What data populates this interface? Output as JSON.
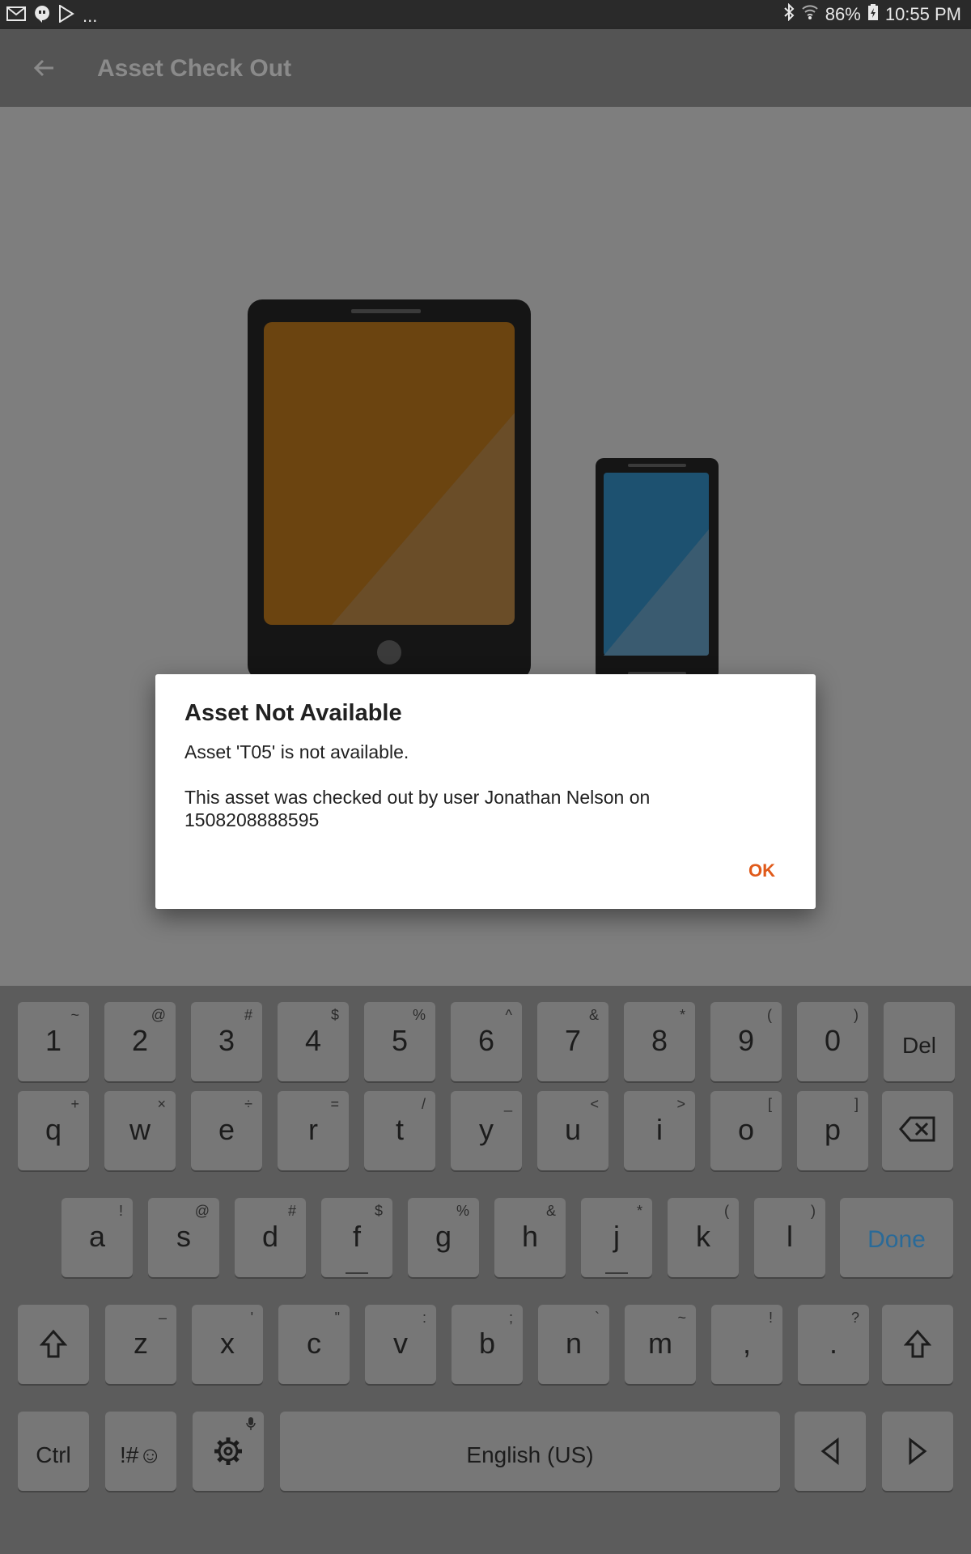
{
  "status_bar": {
    "battery": "86%",
    "time": "10:55 PM",
    "notification_overflow": "...",
    "icons": [
      "gmail-icon",
      "hangouts-icon",
      "play-store-icon",
      "bluetooth-icon",
      "wifi-icon",
      "battery-icon"
    ]
  },
  "app_bar": {
    "title": "Asset Check Out",
    "back_icon": "arrow-back-icon"
  },
  "dialog": {
    "title": "Asset Not Available",
    "line1": "Asset 'T05' is not available.",
    "line2": "This asset was checked out by user Jonathan Nelson on",
    "line3": "1508208888595",
    "ok_label": "OK"
  },
  "colors": {
    "accent": "#e05a1a",
    "done_key": "#2a6a98",
    "tablet_screen": "#6b4410",
    "phone_screen": "#1d5170"
  },
  "keyboard": {
    "row1": [
      {
        "main": "1",
        "sub": "~"
      },
      {
        "main": "2",
        "sub": "@"
      },
      {
        "main": "3",
        "sub": "#"
      },
      {
        "main": "4",
        "sub": "$"
      },
      {
        "main": "5",
        "sub": "%"
      },
      {
        "main": "6",
        "sub": "^"
      },
      {
        "main": "7",
        "sub": "&"
      },
      {
        "main": "8",
        "sub": "*"
      },
      {
        "main": "9",
        "sub": "("
      },
      {
        "main": "0",
        "sub": ")"
      },
      {
        "main": "Del",
        "sub": ""
      }
    ],
    "row2": [
      {
        "main": "q",
        "sub": "+"
      },
      {
        "main": "w",
        "sub": "×"
      },
      {
        "main": "e",
        "sub": "÷"
      },
      {
        "main": "r",
        "sub": "="
      },
      {
        "main": "t",
        "sub": "/"
      },
      {
        "main": "y",
        "sub": "_"
      },
      {
        "main": "u",
        "sub": "<"
      },
      {
        "main": "i",
        "sub": ">"
      },
      {
        "main": "o",
        "sub": "["
      },
      {
        "main": "p",
        "sub": "]"
      }
    ],
    "row3": [
      {
        "main": "a",
        "sub": "!"
      },
      {
        "main": "s",
        "sub": "@"
      },
      {
        "main": "d",
        "sub": "#"
      },
      {
        "main": "f",
        "sub": "$"
      },
      {
        "main": "g",
        "sub": "%"
      },
      {
        "main": "h",
        "sub": "&"
      },
      {
        "main": "j",
        "sub": "*"
      },
      {
        "main": "k",
        "sub": "("
      },
      {
        "main": "l",
        "sub": ")"
      }
    ],
    "done_label": "Done",
    "row4": [
      {
        "main": "z",
        "sub": "–"
      },
      {
        "main": "x",
        "sub": "'"
      },
      {
        "main": "c",
        "sub": "\""
      },
      {
        "main": "v",
        "sub": ":"
      },
      {
        "main": "b",
        "sub": ";"
      },
      {
        "main": "n",
        "sub": "`"
      },
      {
        "main": "m",
        "sub": "~"
      },
      {
        "main": ",",
        "sub": "!"
      },
      {
        "main": ".",
        "sub": "?"
      }
    ],
    "ctrl_label": "Ctrl",
    "symbols_label": "!#☺",
    "space_label": "English (US)"
  }
}
